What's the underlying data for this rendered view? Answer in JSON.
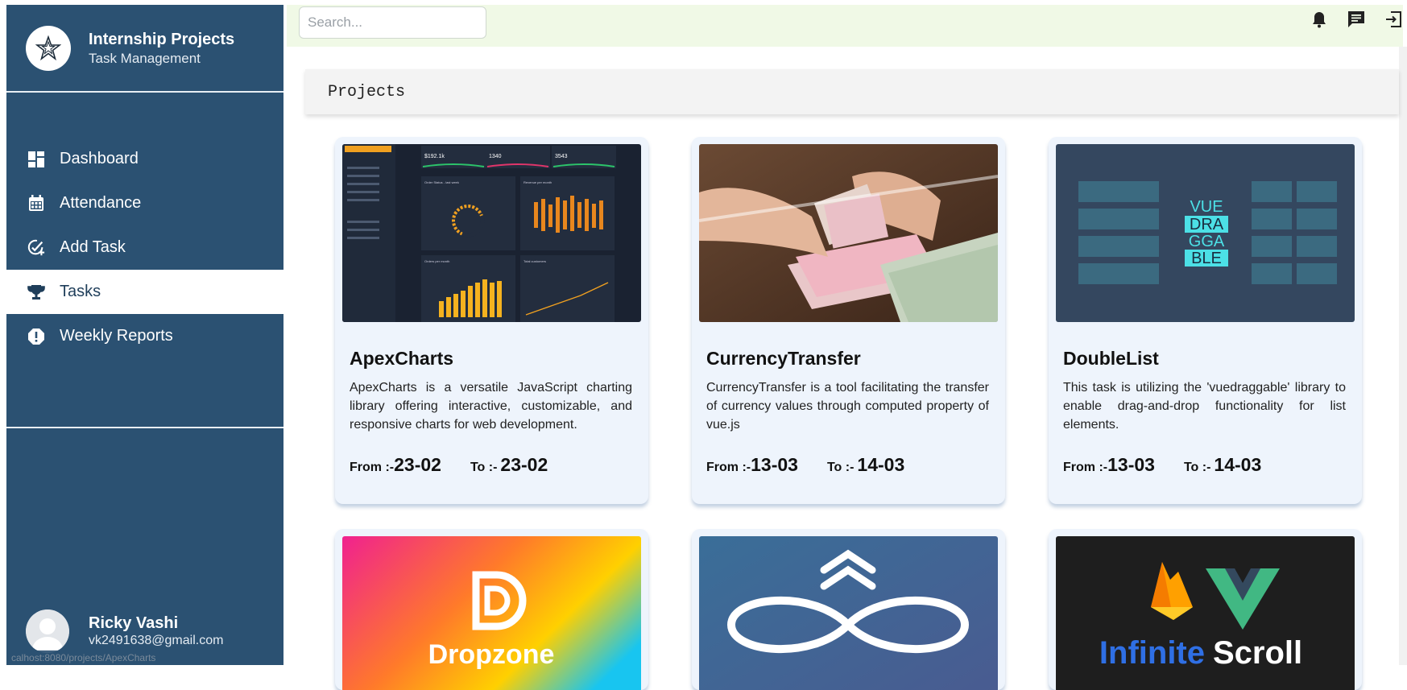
{
  "app": {
    "title": "Internship Projects",
    "subtitle": "Task Management"
  },
  "sidebar": {
    "items": [
      {
        "label": "Dashboard",
        "icon": "dashboard-icon",
        "active": false
      },
      {
        "label": "Attendance",
        "icon": "calendar-icon",
        "active": false
      },
      {
        "label": "Add Task",
        "icon": "add-task-icon",
        "active": false
      },
      {
        "label": "Tasks",
        "icon": "trophy-icon",
        "active": true
      },
      {
        "label": "Weekly Reports",
        "icon": "alert-icon",
        "active": false
      }
    ],
    "user": {
      "name": "Ricky Vashi",
      "email": "vk2491638@gmail.com"
    },
    "status_url": "calhost:8080/projects/ApexCharts"
  },
  "topbar": {
    "search_placeholder": "Search...",
    "icons": [
      "bell-icon",
      "message-icon",
      "logout-icon"
    ]
  },
  "page": {
    "title": "Projects"
  },
  "projects": [
    {
      "name": "ApexCharts",
      "description": "ApexCharts is a versatile JavaScript charting library offering interactive, customizable, and responsive charts for web development.",
      "from_label": "From :-",
      "from": "23-02",
      "to_label": "To :-",
      "to": "23-02"
    },
    {
      "name": "CurrencyTransfer",
      "description": "CurrencyTransfer is a tool facilitating the transfer of currency values through computed property of vue.js",
      "from_label": "From :-",
      "from": "13-03",
      "to_label": "To :-",
      "to": "14-03"
    },
    {
      "name": "DoubleList",
      "description": "This task is utilizing the 'vuedraggable' library to enable drag-and-drop functionality for list elements.",
      "from_label": "From :-",
      "from": "13-03",
      "to_label": "To :-",
      "to": "14-03"
    },
    {
      "thumb_text": "Dropzone"
    },
    {
      "thumb_text": ""
    },
    {
      "thumb_text_1": "Infinite",
      "thumb_text_2": "Scroll"
    }
  ],
  "thumb_texts": {
    "vue_lines": [
      "VUE",
      "DRA",
      "GGA",
      "BLE"
    ],
    "apex_stats": [
      "$192.1k",
      "1340",
      "3543"
    ],
    "apex_panels": [
      "Order Status - last week",
      "Revenue per month",
      "Orders per month",
      "Total customers"
    ]
  },
  "colors": {
    "sidebar": "#2b5172",
    "topbar": "#f0f9e6",
    "card": "#eef4fc"
  }
}
